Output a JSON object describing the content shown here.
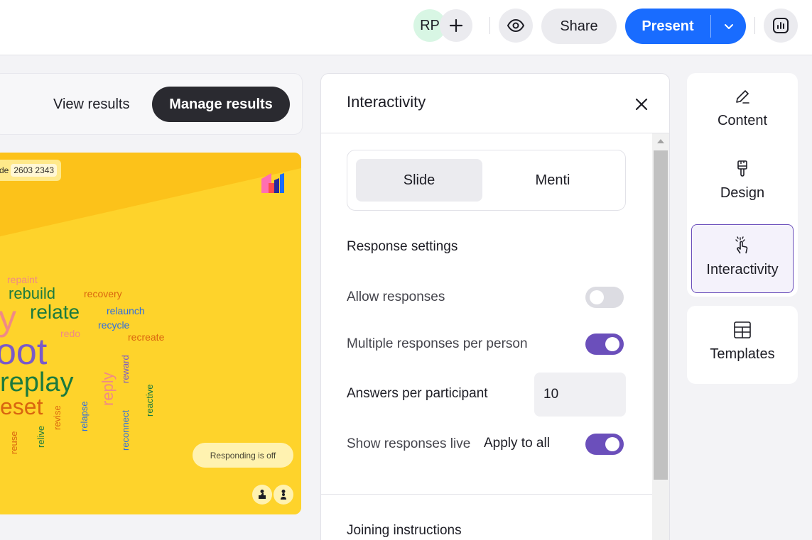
{
  "topbar": {
    "avatar_initials": "RP",
    "add_icon": "plus-icon",
    "preview_icon": "eye-icon",
    "share_label": "Share",
    "present_label": "Present",
    "present_caret_icon": "chevron-down-icon",
    "results_icon": "bar-chart-icon"
  },
  "results": {
    "view_label": "View results",
    "manage_label": "Manage results"
  },
  "slide": {
    "join_prefix": "de",
    "join_code": "2603 2343",
    "responding_label": "Responding is off",
    "bg_color": "#fed32b",
    "words": [
      {
        "text": "repaint",
        "color": "#f08a86"
      },
      {
        "text": "rebuild",
        "color": "#1b7a3e"
      },
      {
        "text": "recovery",
        "color": "#d9650f"
      },
      {
        "text": "y",
        "color": "#f08a86"
      },
      {
        "text": "relate",
        "color": "#1b7a3e"
      },
      {
        "text": "relaunch",
        "color": "#2f6ee0"
      },
      {
        "text": "recycle",
        "color": "#2f6ee0"
      },
      {
        "text": "redo",
        "color": "#f08a86"
      },
      {
        "text": "recreate",
        "color": "#d9650f"
      },
      {
        "text": "oot",
        "color": "#7a5ac8"
      },
      {
        "text": "replay",
        "color": "#1b7a3e"
      },
      {
        "text": "eset",
        "color": "#d9650f"
      },
      {
        "text": "reward",
        "color": "#7a5ac8"
      },
      {
        "text": "reply",
        "color": "#f08a86"
      },
      {
        "text": "reactive",
        "color": "#1b7a3e"
      },
      {
        "text": "revise",
        "color": "#d9650f"
      },
      {
        "text": "relapse",
        "color": "#2f6ee0"
      },
      {
        "text": "reconnect",
        "color": "#2f6ee0"
      },
      {
        "text": "relive",
        "color": "#1b7a3e"
      },
      {
        "text": "reuse",
        "color": "#d9650f"
      }
    ]
  },
  "panel": {
    "title": "Interactivity",
    "tabs": [
      "Slide",
      "Menti"
    ],
    "response_settings_title": "Response settings",
    "allow_responses_label": "Allow responses",
    "allow_responses_on": false,
    "multiple_responses_label": "Multiple responses per person",
    "multiple_responses_on": true,
    "answers_label": "Answers per participant",
    "answers_value": "10",
    "show_live_label": "Show responses live",
    "apply_all_label": "Apply to all",
    "show_live_on": true,
    "joining_title": "Joining instructions"
  },
  "sidebar": {
    "items": [
      {
        "label": "Content",
        "icon": "pencil-icon"
      },
      {
        "label": "Design",
        "icon": "paintbrush-icon"
      },
      {
        "label": "Interactivity",
        "icon": "tap-hand-icon",
        "active": true
      },
      {
        "label": "Templates",
        "icon": "table-grid-icon"
      }
    ]
  },
  "colors": {
    "accent_blue": "#196cff",
    "toggle_purple": "#6b4fbb"
  }
}
